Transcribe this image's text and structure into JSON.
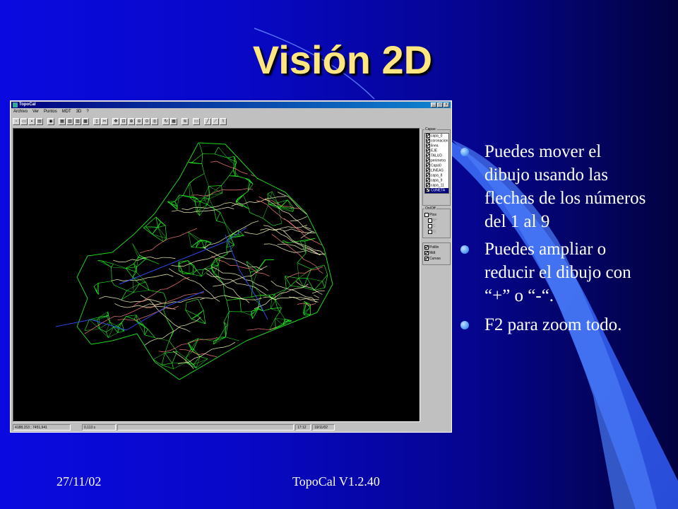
{
  "slide": {
    "title": "Visión 2D",
    "bullets": [
      "Puedes mover el dibujo usando las flechas de los números del 1 al 9",
      "Puedes ampliar o reducir el dibujo con “+” o “-“.",
      "F2 para zoom todo."
    ],
    "footer_date": "27/11/02",
    "footer_title": "TopoCal V1.2.40"
  },
  "app": {
    "title": "TopoCal",
    "menu": [
      "Archivo",
      "Ver",
      "Puntos",
      "MDT",
      "3D",
      "?"
    ],
    "panel": {
      "layers_label": "Capas:",
      "layers": [
        {
          "name": "capa_0",
          "checked": true
        },
        {
          "name": "coronacion",
          "checked": true
        },
        {
          "name": "linea",
          "checked": true
        },
        {
          "name": "EJE",
          "checked": true
        },
        {
          "name": "TALUD",
          "checked": true
        },
        {
          "name": "perimetro",
          "checked": true
        },
        {
          "name": "Capa0",
          "checked": true
        },
        {
          "name": "LINEAS",
          "checked": true
        },
        {
          "name": "capa_8",
          "checked": true
        },
        {
          "name": "capa_9",
          "checked": true
        },
        {
          "name": "capa_11",
          "checked": true
        },
        {
          "name": "CUNETA",
          "checked": true,
          "selected": true
        }
      ],
      "onoff_label": "On/Off",
      "onoff_main": "Ptos",
      "onoff_sub": [
        "N°",
        "C",
        "G"
      ],
      "view_options": [
        "Polilin",
        "Mdt",
        "Curvas"
      ]
    },
    "status": {
      "coords": "4188,153 ; 7451,941",
      "time": "0,113 s",
      "clock": "17:12",
      "date": "19/11/02"
    }
  },
  "colors": {
    "title": "#ffe680",
    "mesh": "#22ee22",
    "contour": "#ffffc0",
    "contour_alt": "#ff8080",
    "polyline": "#3050ff"
  }
}
